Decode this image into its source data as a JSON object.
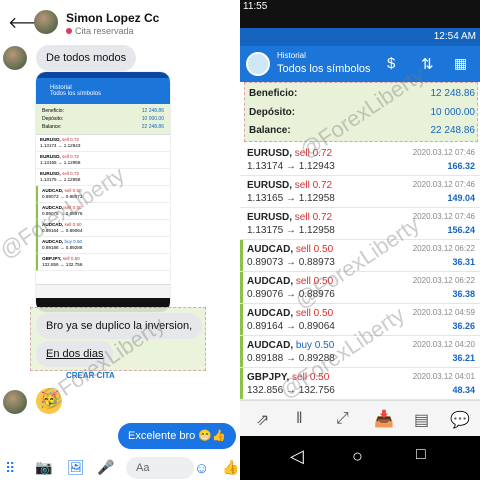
{
  "chat": {
    "contact_name": "Simon Lopez Cc",
    "contact_status": "Cita reservada",
    "msg1": "De todos modos",
    "msg2_line1": "Bro ya se duplico la inversion,",
    "msg2_line2": "En dos dias",
    "crear_cita": "CREAR CITA",
    "sent_msg": "Excelente bro 😁👍",
    "input_placeholder": "Aa",
    "emoji_reaction": "🥳"
  },
  "mini": {
    "title_small": "Historial",
    "title": "Todos los símbolos",
    "summary": [
      {
        "k": "Beneficio:",
        "v": "12 248.86"
      },
      {
        "k": "Depósito:",
        "v": "10 000.00"
      },
      {
        "k": "Balance:",
        "v": "22 248.86"
      }
    ],
    "time": "12:54 AM"
  },
  "status": {
    "time": "11:55",
    "clock": "12:54 AM"
  },
  "terminal": {
    "title_small": "Historial",
    "title": "Todos los símbolos",
    "summary": [
      {
        "k": "Beneficio:",
        "v": "12 248.86"
      },
      {
        "k": "Depósito:",
        "v": "10 000.00"
      },
      {
        "k": "Balance:",
        "v": "22 248.86"
      }
    ],
    "trades": [
      {
        "sym": "EURUSD,",
        "type": "sell 0.72",
        "buy": false,
        "from": "1.13174",
        "to": "1.12943",
        "date": "2020.03.12 07:46",
        "pl": "166.32",
        "green": false
      },
      {
        "sym": "EURUSD,",
        "type": "sell 0.72",
        "buy": false,
        "from": "1.13165",
        "to": "1.12958",
        "date": "2020.03.12 07:46",
        "pl": "149.04",
        "green": false
      },
      {
        "sym": "EURUSD,",
        "type": "sell 0.72",
        "buy": false,
        "from": "1.13175",
        "to": "1.12958",
        "date": "2020.03.12 07:46",
        "pl": "156.24",
        "green": false
      },
      {
        "sym": "AUDCAD,",
        "type": "sell 0.50",
        "buy": false,
        "from": "0.89073",
        "to": "0.88973",
        "date": "2020.03.12 06:22",
        "pl": "36.31",
        "green": true
      },
      {
        "sym": "AUDCAD,",
        "type": "sell 0.50",
        "buy": false,
        "from": "0.89076",
        "to": "0.88976",
        "date": "2020.03.12 06:22",
        "pl": "36.38",
        "green": true
      },
      {
        "sym": "AUDCAD,",
        "type": "sell 0.50",
        "buy": false,
        "from": "0.89164",
        "to": "0.89064",
        "date": "2020.03.12 04:59",
        "pl": "36.26",
        "green": true
      },
      {
        "sym": "AUDCAD,",
        "type": "buy 0.50",
        "buy": true,
        "from": "0.89188",
        "to": "0.89288",
        "date": "2020.03.12 04:20",
        "pl": "36.21",
        "green": true
      },
      {
        "sym": "GBPJPY,",
        "type": "sell 0.50",
        "buy": false,
        "from": "132.856",
        "to": "132.756",
        "date": "2020.03.12 04:01",
        "pl": "48.34",
        "green": true
      }
    ]
  },
  "watermark": "@ForexLiberty"
}
